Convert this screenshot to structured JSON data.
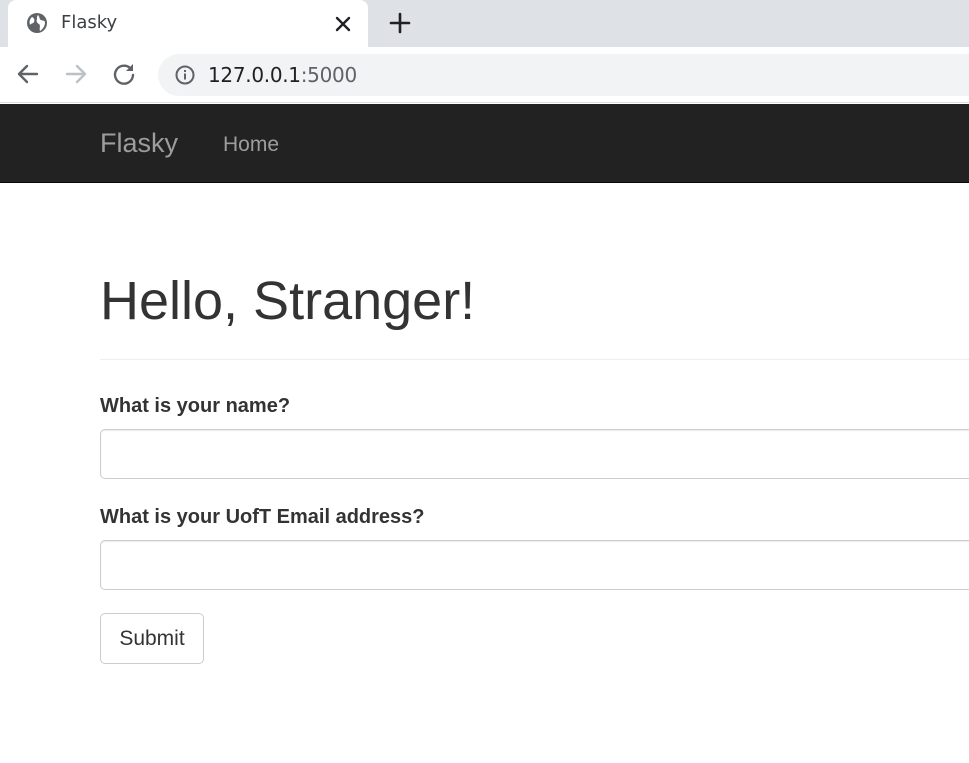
{
  "browser": {
    "tab": {
      "title": "Flasky",
      "favicon": "globe-icon",
      "close_icon": "close-icon"
    },
    "new_tab_icon": "plus-icon",
    "nav": {
      "back_icon": "arrow-left-icon",
      "forward_icon": "arrow-right-icon",
      "reload_icon": "reload-icon"
    },
    "address_bar": {
      "info_icon": "info-icon",
      "url_host": "127.0.0.1",
      "url_port": ":5000"
    }
  },
  "navbar": {
    "brand": "Flasky",
    "links": [
      {
        "label": "Home"
      }
    ]
  },
  "page": {
    "heading": "Hello, Stranger!",
    "form": {
      "name_label": "What is your name?",
      "name_value": "",
      "email_label": "What is your UofT Email address?",
      "email_value": "",
      "submit_label": "Submit"
    }
  },
  "colors": {
    "navbar_bg": "#222222",
    "navbar_text": "#9d9d9d",
    "tabbar_bg": "#dee1e6",
    "heading_text": "#333333"
  }
}
